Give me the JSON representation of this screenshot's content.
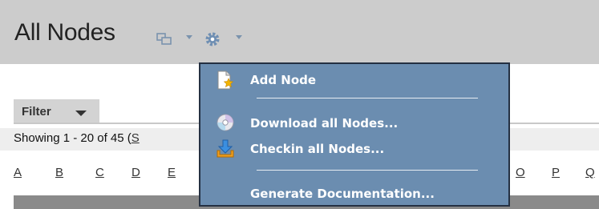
{
  "header": {
    "title": "All Nodes",
    "icons": [
      "view-icon",
      "gear-icon"
    ]
  },
  "filter": {
    "label": "Filter"
  },
  "showing": {
    "text": "Showing 1 - 20 of 45 (",
    "link": "S"
  },
  "alphabet": [
    "A",
    "B",
    "C",
    "D",
    "E",
    "O",
    "P",
    "Q"
  ],
  "menu": {
    "items": [
      {
        "label": "Add Node",
        "icon": "add-document-icon"
      },
      {
        "label": "Download all Nodes...",
        "icon": "disc-icon"
      },
      {
        "label": "Checkin all Nodes...",
        "icon": "checkin-icon"
      },
      {
        "label": "Generate Documentation...",
        "icon": ""
      }
    ]
  },
  "colors": {
    "header_bg": "#cccccc",
    "menu_bg": "#6b8db0",
    "menu_border": "#243042"
  }
}
